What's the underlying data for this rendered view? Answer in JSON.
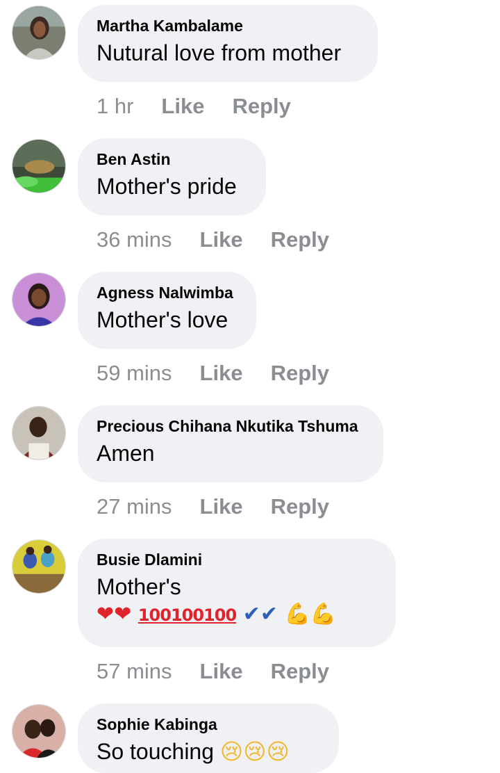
{
  "comments": [
    {
      "author": "Martha Kambalame",
      "text": "Nutural love from mother",
      "time": "1 hr",
      "like": "Like",
      "reply": "Reply"
    },
    {
      "author": "Ben Astin",
      "text": "Mother's pride",
      "time": "36 mins",
      "like": "Like",
      "reply": "Reply"
    },
    {
      "author": "Agness Nalwimba",
      "text": "Mother's love",
      "time": "59 mins",
      "like": "Like",
      "reply": "Reply"
    },
    {
      "author": "Precious Chihana Nkutika Tshuma",
      "text": "Amen",
      "time": "27 mins",
      "like": "Like",
      "reply": "Reply"
    },
    {
      "author": "Busie Dlamini",
      "text": "Mother's",
      "emojis": {
        "heart": "❤",
        "hundred": "100",
        "check": "✔",
        "muscle": "💪"
      },
      "time": "57 mins",
      "like": "Like",
      "reply": "Reply"
    },
    {
      "author": "Sophie Kabinga",
      "text": "So touching",
      "emojis": {
        "cry": "😢"
      }
    }
  ],
  "colors": {
    "bubble": "#eff1f4",
    "text": "#050505",
    "meta": "#8a8d91"
  }
}
